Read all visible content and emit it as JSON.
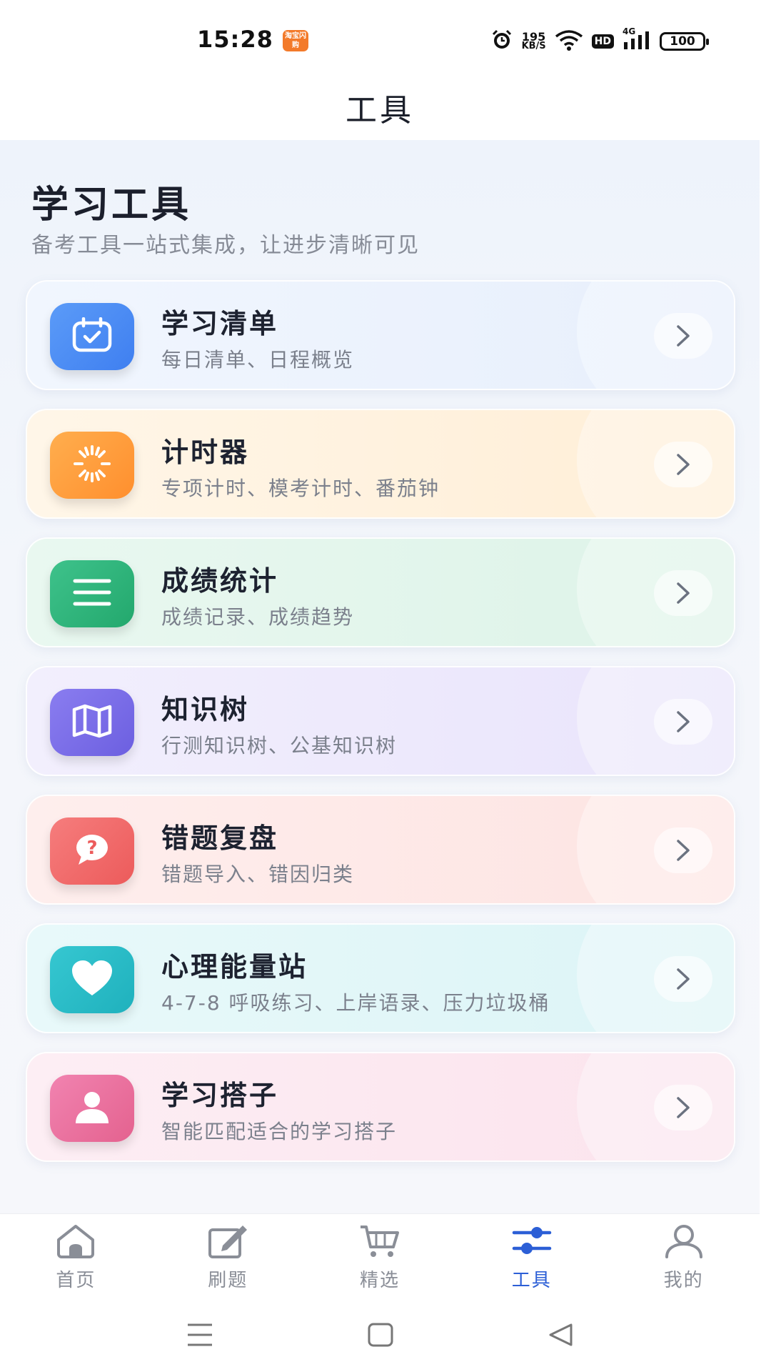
{
  "status_bar": {
    "time": "15:28",
    "app_badge": "淘宝闪购",
    "net_speed_value": "195",
    "net_speed_unit": "KB/S",
    "hd_label": "HD",
    "network_type": "4G",
    "battery": "100"
  },
  "header": {
    "title": "工具"
  },
  "section": {
    "title": "学习工具",
    "subtitle": "备考工具一站式集成，让进步清晰可见"
  },
  "tools": [
    {
      "name": "学习清单",
      "desc": "每日清单、日程概览",
      "icon": "calendar-check-icon",
      "accent": "#4f8ff6"
    },
    {
      "name": "计时器",
      "desc": "专项计时、模考计时、番茄钟",
      "icon": "timer-burst-icon",
      "accent": "#ff9c3b"
    },
    {
      "name": "成绩统计",
      "desc": "成绩记录、成绩趋势",
      "icon": "menu-lines-icon",
      "accent": "#2fb67c"
    },
    {
      "name": "知识树",
      "desc": "行测知识树、公基知识树",
      "icon": "map-icon",
      "accent": "#7b6ee6"
    },
    {
      "name": "错题复盘",
      "desc": "错题导入、错因归类",
      "icon": "question-bubble-icon",
      "accent": "#f26a6a"
    },
    {
      "name": "心理能量站",
      "desc": "4-7-8 呼吸练习、上岸语录、压力垃圾桶",
      "icon": "heart-icon",
      "accent": "#22b7c4"
    },
    {
      "name": "学习搭子",
      "desc": "智能匹配适合的学习搭子",
      "icon": "person-icon",
      "accent": "#ec6fa0"
    }
  ],
  "bottom_nav": [
    {
      "label": "首页",
      "icon": "home-icon",
      "active": false
    },
    {
      "label": "刷题",
      "icon": "edit-icon",
      "active": false
    },
    {
      "label": "精选",
      "icon": "cart-icon",
      "active": false
    },
    {
      "label": "工具",
      "icon": "sliders-icon",
      "active": true
    },
    {
      "label": "我的",
      "icon": "user-icon",
      "active": false
    }
  ],
  "colors": {
    "active_tab": "#2c5fd6",
    "inactive_tab": "#8a8e97"
  }
}
